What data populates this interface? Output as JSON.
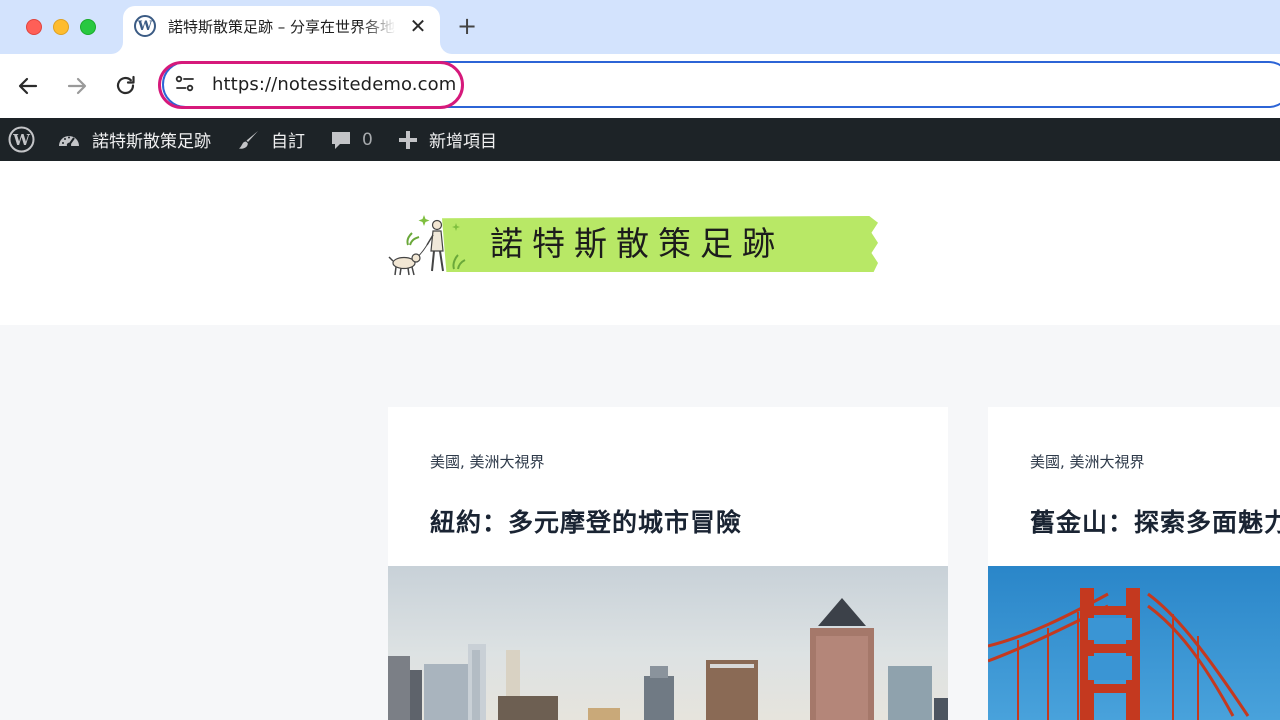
{
  "browser": {
    "tab": {
      "title": "諾特斯散策足跡 – 分享在世界各地的旅行筆記",
      "favicon": "wordpress-icon"
    },
    "address_bar": {
      "url": "https://notessitedemo.com",
      "highlight_color": "#d6197b"
    }
  },
  "admin_bar": {
    "site_name": "諾特斯散策足跡",
    "customize_label": "自訂",
    "comments_count": "0",
    "new_label": "新增項目"
  },
  "header": {
    "logo_text": "諾特斯散策足跡",
    "logo_color": "#b8e866"
  },
  "posts": [
    {
      "categories": "美國, 美洲大視界",
      "title": "紐約：多元摩登的城市冒險"
    },
    {
      "categories": "美國, 美洲大視界",
      "title": "舊金山：探索多面魅力"
    }
  ],
  "colors": {
    "tab_strip": "#d3e3fd",
    "admin_bar": "#1d2327",
    "omnibox_border": "#2c64d6",
    "content_bg": "#f6f7f9"
  }
}
